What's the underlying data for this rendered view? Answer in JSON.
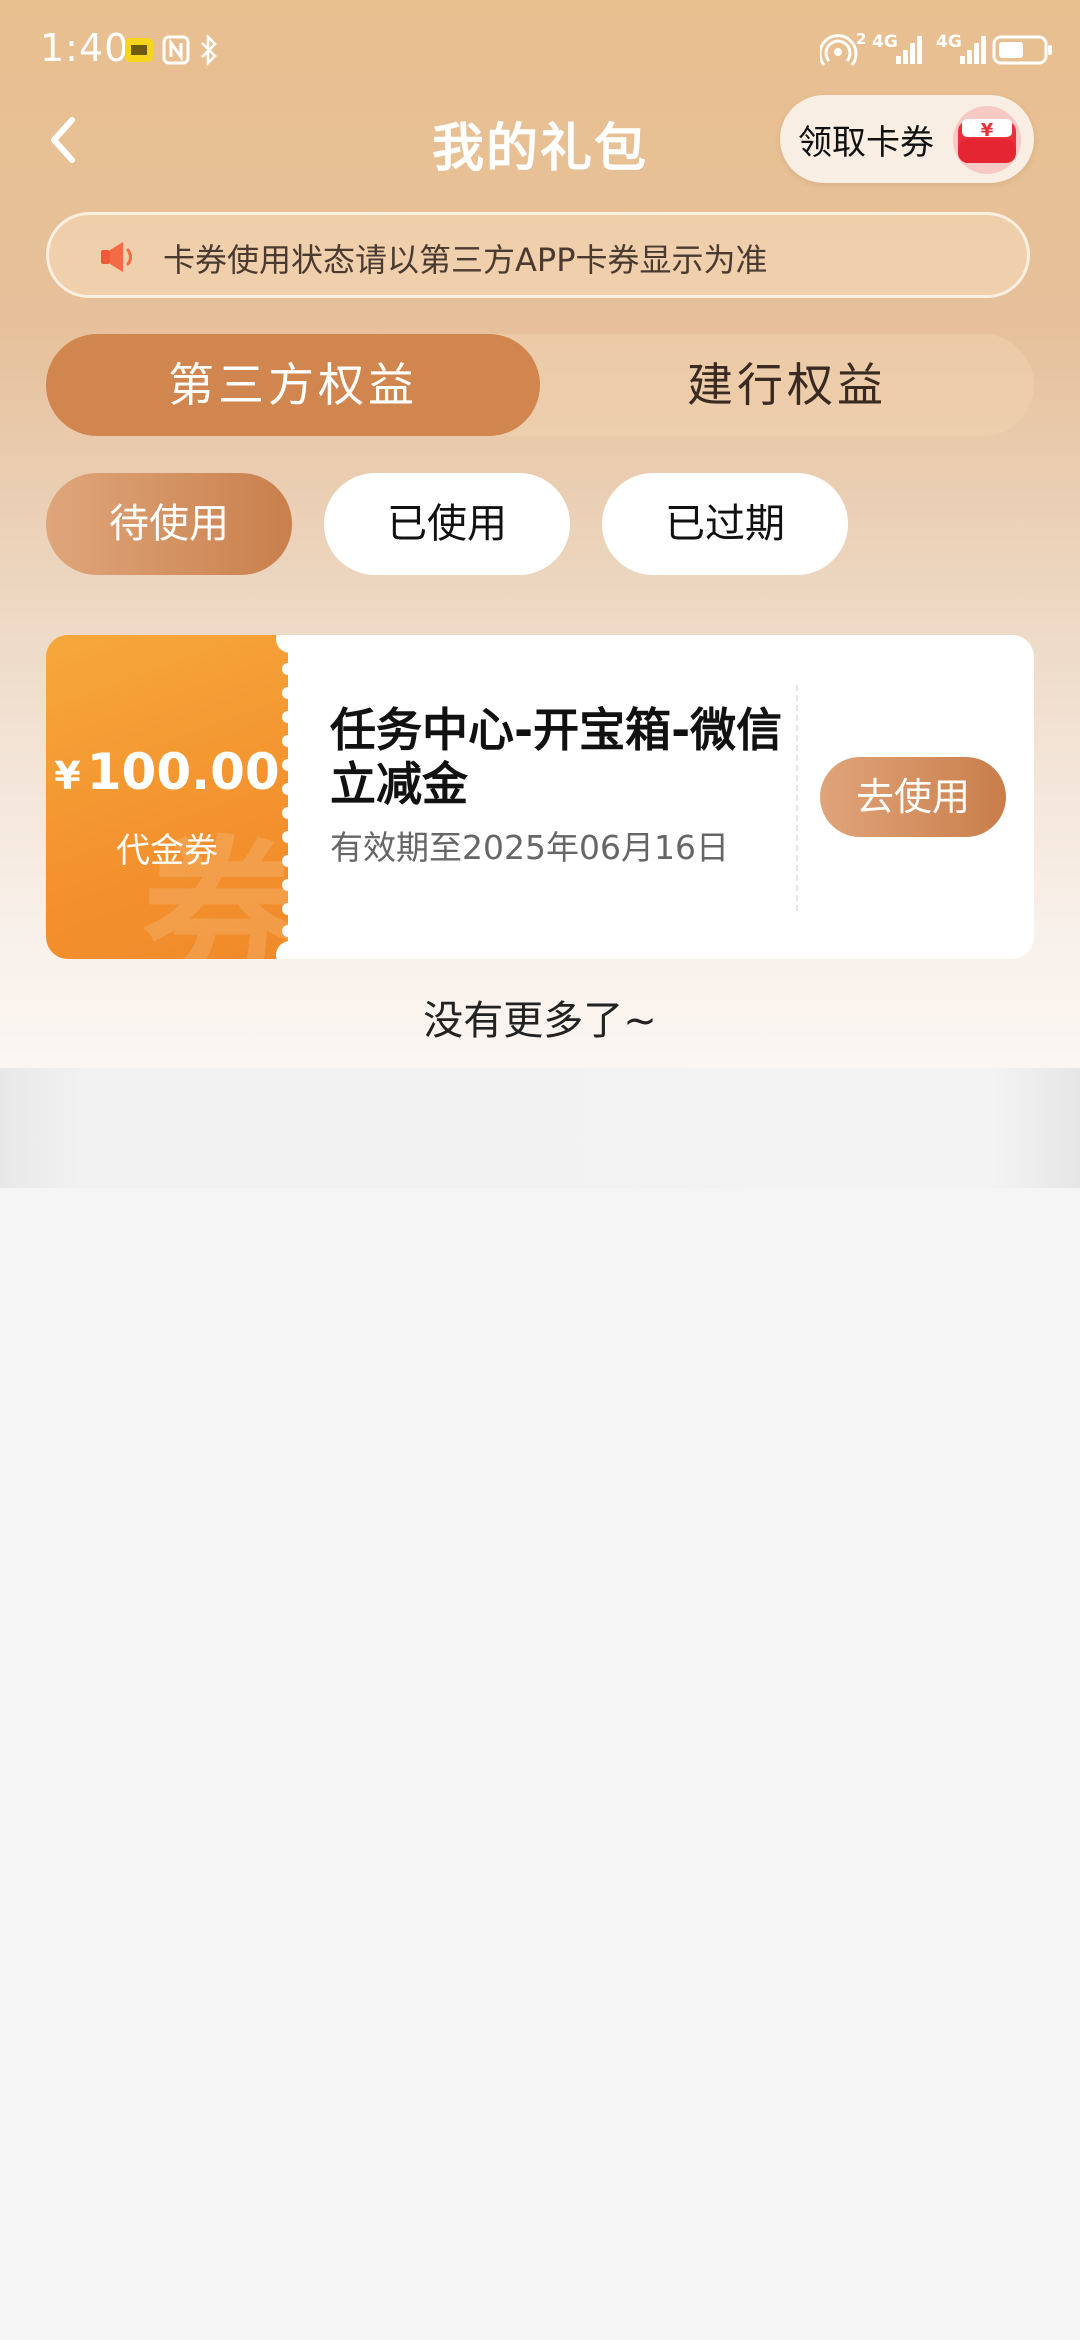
{
  "status_bar": {
    "time": "1:40",
    "net_badge_1": "4G",
    "net_badge_2": "4G",
    "hotspot_count": "2"
  },
  "header": {
    "title": "我的礼包",
    "claim_button": "领取卡券"
  },
  "notice": {
    "text": "卡券使用状态请以第三方APP卡券显示为准"
  },
  "main_tabs": [
    {
      "label": "第三方权益",
      "active": true
    },
    {
      "label": "建行权益",
      "active": false
    }
  ],
  "filter_tabs": [
    {
      "label": "待使用",
      "active": true
    },
    {
      "label": "已使用",
      "active": false
    },
    {
      "label": "已过期",
      "active": false
    }
  ],
  "coupon": {
    "currency": "¥",
    "amount": "100.00",
    "type": "代金券",
    "watermark": "券",
    "title": "任务中心-开宝箱-微信立减金",
    "validity": "有效期至2025年06月16日",
    "action": "去使用"
  },
  "footer": {
    "no_more": "没有更多了~"
  },
  "colors": {
    "accent": "#d0864e",
    "coupon_orange": "#f3922e",
    "hero_top": "#e8bf8f"
  }
}
